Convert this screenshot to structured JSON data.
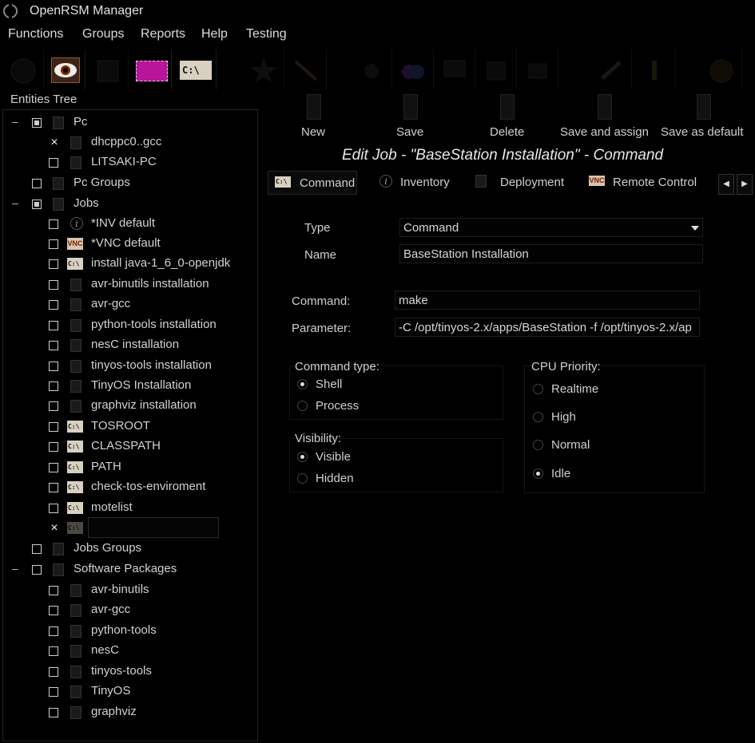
{
  "window": {
    "title": "OpenRSM Manager"
  },
  "menu": [
    "Functions",
    "Groups",
    "Reports",
    "Help",
    "Testing"
  ],
  "toolbar": {
    "icons": [
      "power-icon",
      "eye-icon",
      "report-icon",
      "chip-icon",
      "command-icon",
      "star-icon",
      "wand-icon",
      "gear-icon",
      "color-icon",
      "pc-icon",
      "network-icon",
      "print-icon",
      "tool-icon",
      "info-icon",
      "globe-icon"
    ],
    "command_icon_text": "C:\\"
  },
  "tree": {
    "title": "Entities Tree",
    "pc": "Pc",
    "pc_items": [
      "dhcppc0..gcc",
      "LITSAKI-PC"
    ],
    "pc_groups": "Pc Groups",
    "jobs": "Jobs",
    "job_items": [
      "*INV default",
      "*VNC default",
      "install java-1_6_0-openjdk",
      "avr-binutils installation",
      "avr-gcc",
      "python-tools installation",
      "nesC installation",
      "tinyos-tools installation",
      "TinyOS Installation",
      "graphviz installation",
      "TOSROOT",
      "CLASSPATH",
      "PATH",
      "check-tos-enviroment",
      "motelist"
    ],
    "jobs_groups": "Jobs Groups",
    "software_packages": "Software Packages",
    "software_items": [
      "avr-binutils",
      "avr-gcc",
      "python-tools",
      "nesC",
      "tinyos-tools",
      "TinyOS",
      "graphviz"
    ],
    "collapse_glyph": "–",
    "checked_glyph": "×",
    "info_glyph": "i",
    "vnc_glyph": "VNC"
  },
  "actions": [
    "New",
    "Save",
    "Delete",
    "Save and assign",
    "Save as default"
  ],
  "heading": "Edit Job - \"BaseStation Installation\" - Command",
  "tabs": [
    "Command",
    "Inventory",
    "Deployment",
    "Remote Control"
  ],
  "form": {
    "type_label": "Type",
    "type_value": "Command",
    "name_label": "Name",
    "name_value": "BaseStation Installation",
    "command_label": "Command:",
    "command_value": "make",
    "parameter_label": "Parameter:",
    "parameter_value": "-C /opt/tinyos-2.x/apps/BaseStation -f /opt/tinyos-2.x/ap",
    "command_type_label": "Command type:",
    "command_type_options": [
      "Shell",
      "Process"
    ],
    "command_type_selected": "Shell",
    "visibility_label": "Visibility:",
    "visibility_options": [
      "Visible",
      "Hidden"
    ],
    "visibility_selected": "Visible",
    "cpu_priority_label": "CPU Priority:",
    "cpu_priority_options": [
      "Realtime",
      "High",
      "Normal",
      "Idle"
    ],
    "cpu_priority_selected": "Idle"
  },
  "nav_arrows": [
    "◀",
    "▶"
  ]
}
